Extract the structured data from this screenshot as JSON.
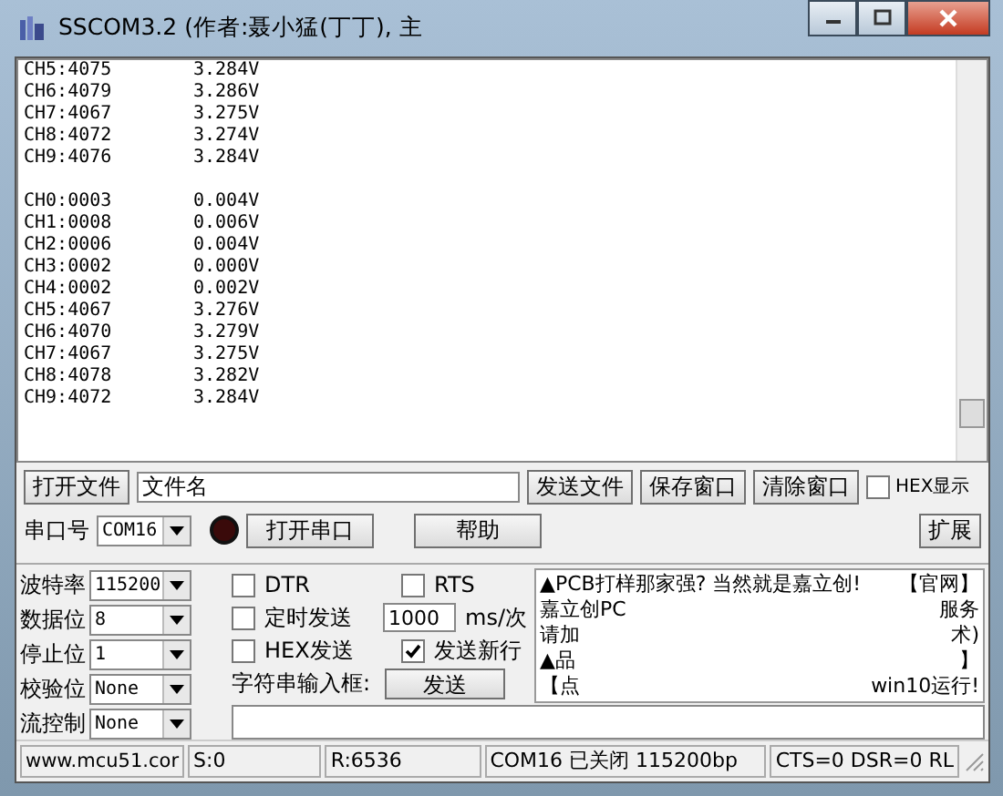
{
  "window": {
    "title": "SSCOM3.2 (作者:聂小猛(丁丁), 主"
  },
  "output": {
    "blocks": [
      [
        {
          "channel": "CH5:4075",
          "voltage": "3.284V"
        },
        {
          "channel": "CH6:4079",
          "voltage": "3.286V"
        },
        {
          "channel": "CH7:4067",
          "voltage": "3.275V"
        },
        {
          "channel": "CH8:4072",
          "voltage": "3.274V"
        },
        {
          "channel": "CH9:4076",
          "voltage": "3.284V"
        }
      ],
      [
        {
          "channel": "CH0:0003",
          "voltage": "0.004V"
        },
        {
          "channel": "CH1:0008",
          "voltage": "0.006V"
        },
        {
          "channel": "CH2:0006",
          "voltage": "0.004V"
        },
        {
          "channel": "CH3:0002",
          "voltage": "0.000V"
        },
        {
          "channel": "CH4:0002",
          "voltage": "0.002V"
        },
        {
          "channel": "CH5:4067",
          "voltage": "3.276V"
        },
        {
          "channel": "CH6:4070",
          "voltage": "3.279V"
        },
        {
          "channel": "CH7:4067",
          "voltage": "3.275V"
        },
        {
          "channel": "CH8:4078",
          "voltage": "3.282V"
        },
        {
          "channel": "CH9:4072",
          "voltage": "3.284V"
        }
      ]
    ]
  },
  "file_row": {
    "open_file": "打开文件",
    "file_name": "文件名",
    "send_file": "发送文件",
    "save_window": "保存窗口",
    "clear_window": "清除窗口",
    "hex_display": {
      "label": "HEX显示",
      "checked": false
    }
  },
  "port_row": {
    "label": "串口号",
    "port": "COM16",
    "port_open": false,
    "open_button": "打开串口",
    "help": "帮助",
    "expand": "扩展"
  },
  "settings": [
    {
      "label": "波特率",
      "value": "115200"
    },
    {
      "label": "数据位",
      "value": "8"
    },
    {
      "label": "停止位",
      "value": "1"
    },
    {
      "label": "校验位",
      "value": "None"
    },
    {
      "label": "流控制",
      "value": "None"
    }
  ],
  "options": {
    "dtr": {
      "label": "DTR",
      "checked": false
    },
    "rts": {
      "label": "RTS",
      "checked": false
    },
    "timed_send": {
      "label": "定时发送",
      "checked": false
    },
    "interval": "1000",
    "unit": "ms/次",
    "hex_send": {
      "label": "HEX发送",
      "checked": false
    },
    "send_newline": {
      "label": "发送新行",
      "checked": true
    },
    "input_label": "字符串输入框:",
    "send": "发送"
  },
  "ad_lines": [
    {
      "left": "▲PCB打样那家强? 当然就是嘉立创!",
      "right": "【官网】"
    },
    {
      "left": "嘉立创PC",
      "right": "服务"
    },
    {
      "left": "请加",
      "right": "术)"
    },
    {
      "left": "▲品",
      "right": "】"
    },
    {
      "left": "【点",
      "right": "win10运行!"
    }
  ],
  "status_bar": [
    "www.mcu51.cor",
    "S:0",
    "R:6536",
    "COM16 已关闭  115200bp",
    "CTS=0 DSR=0 RL"
  ]
}
